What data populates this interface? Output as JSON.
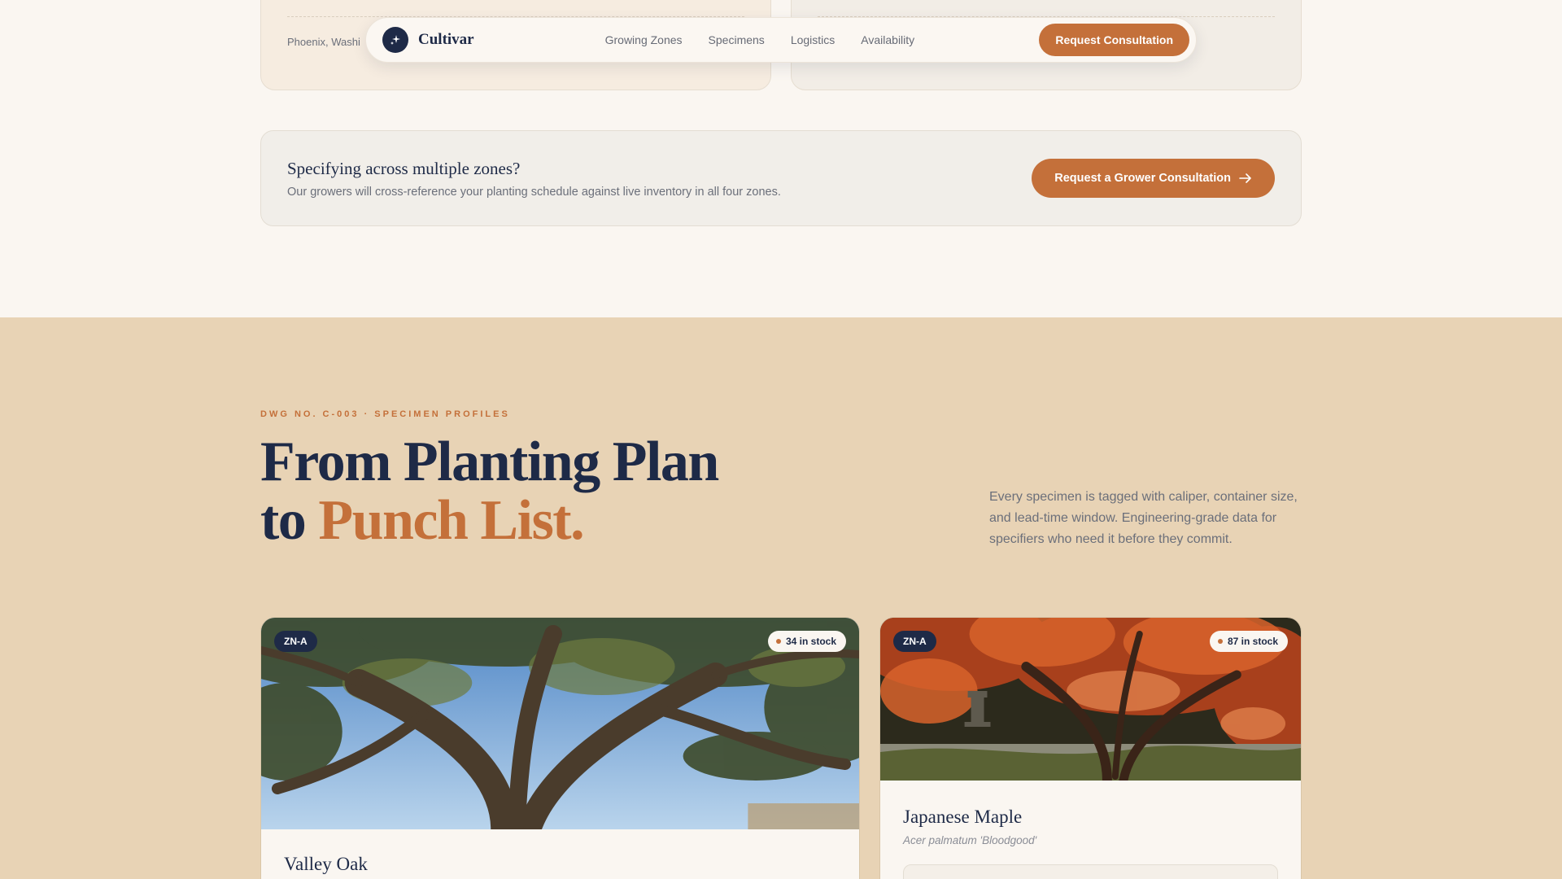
{
  "top_cards": {
    "left_location": "Phoenix, Washi"
  },
  "nav": {
    "brand": "Cultivar",
    "links": [
      "Growing Zones",
      "Specimens",
      "Logistics",
      "Availability"
    ],
    "cta": "Request Consultation"
  },
  "zone_banner": {
    "question": "Specifying across multiple zones?",
    "subtext": "Our growers will cross-reference your planting schedule against live inventory in all four zones.",
    "cta": "Request a Grower Consultation"
  },
  "specimens": {
    "eyebrow": "DWG NO. C-003 · SPECIMEN PROFILES",
    "headline_line1": "From Planting Plan",
    "headline_to": "to",
    "headline_accent": "Punch List.",
    "lead": "Every specimen is tagged with caliper, container size, and lead-time window. Engineering-grade data for specifiers who need it before they commit.",
    "cards": [
      {
        "zone": "ZN-A",
        "stock": "34 in stock",
        "name": "Valley Oak",
        "latin": ""
      },
      {
        "zone": "ZN-A",
        "stock": "87 in stock",
        "name": "Japanese Maple",
        "latin": "Acer palmatum 'Bloodgood'"
      }
    ]
  },
  "colors": {
    "navy": "#1e2a47",
    "accent": "#c4703a",
    "sand": "#e8d3b5",
    "cream": "#faf6f1"
  }
}
